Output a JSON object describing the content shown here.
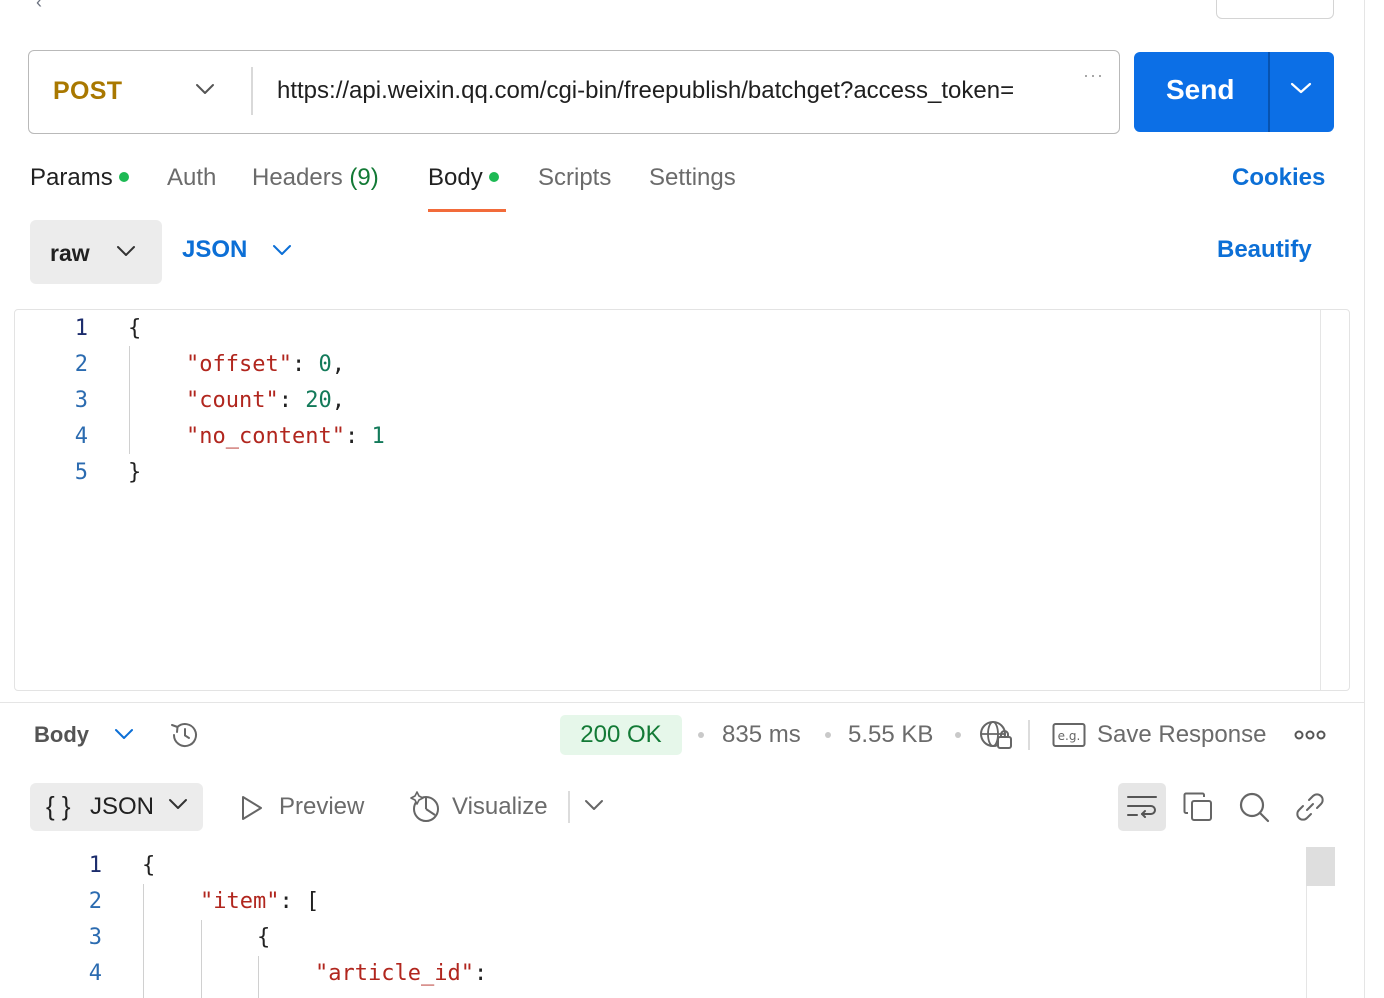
{
  "request": {
    "method": "POST",
    "url": "https://api.weixin.qq.com/cgi-bin/freepublish/batchget?access_token=",
    "send_label": "Send"
  },
  "tabs": {
    "params": "Params",
    "auth": "Auth",
    "headers": "Headers",
    "headers_count": "(9)",
    "body": "Body",
    "scripts": "Scripts",
    "settings": "Settings",
    "cookies": "Cookies"
  },
  "body_options": {
    "mode": "raw",
    "language": "JSON",
    "beautify": "Beautify"
  },
  "request_editor": {
    "line_numbers": [
      "1",
      "2",
      "3",
      "4",
      "5"
    ],
    "open_brace": "{",
    "close_brace": "}",
    "fields": [
      {
        "key": "\"offset\"",
        "value": "0",
        "comma": ","
      },
      {
        "key": "\"count\"",
        "value": "20",
        "comma": ","
      },
      {
        "key": "\"no_content\"",
        "value": "1",
        "comma": ""
      }
    ]
  },
  "response": {
    "body_label": "Body",
    "status": "200 OK",
    "time": "835 ms",
    "size": "5.55 KB",
    "save_response": "Save Response",
    "format_braces": "{ }",
    "format_label": "JSON",
    "preview": "Preview",
    "visualize": "Visualize"
  },
  "response_editor": {
    "line_numbers": [
      "1",
      "2",
      "3",
      "4"
    ],
    "line1": "{",
    "item_key": "\"item\"",
    "item_rest": ": [",
    "line3": "{",
    "article_key": "\"article_id\"",
    "article_rest": ":"
  },
  "colors": {
    "send_button": "#0c6fe6",
    "method": "#a97800",
    "link": "#0c6fd6",
    "status_ok_bg": "#e6f7ea",
    "status_ok_text": "#137a36",
    "active_tab_underline": "#f26b3a"
  }
}
